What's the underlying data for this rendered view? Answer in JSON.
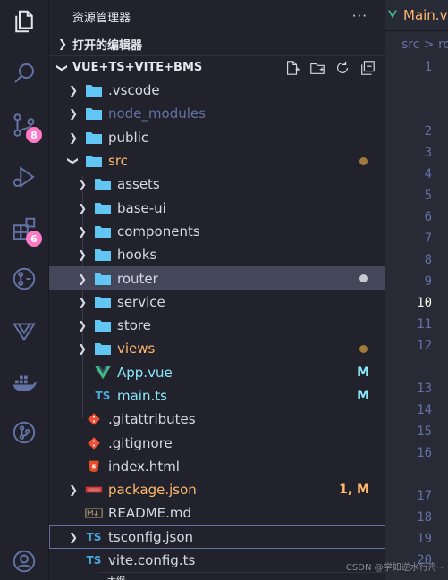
{
  "activity_bar": {
    "scm_badge": "8",
    "extensions_badge": "6"
  },
  "sidebar": {
    "title": "资源管理器",
    "more": "···",
    "open_editors": "打开的编辑器",
    "project": "VUE+TS+VITE+BMS",
    "tree": [
      {
        "label": ".vscode",
        "type": "folder",
        "depth": 1,
        "collapsed": true
      },
      {
        "label": "node_modules",
        "type": "folder",
        "depth": 1,
        "collapsed": true,
        "style": "dim"
      },
      {
        "label": "public",
        "type": "folder",
        "depth": 1,
        "collapsed": true
      },
      {
        "label": "src",
        "type": "folder",
        "depth": 1,
        "expanded": true,
        "style": "orange",
        "dot": "#a07a3a"
      },
      {
        "label": "assets",
        "type": "folder",
        "depth": 2,
        "collapsed": true
      },
      {
        "label": "base-ui",
        "type": "folder",
        "depth": 2,
        "collapsed": true
      },
      {
        "label": "components",
        "type": "folder",
        "depth": 2,
        "collapsed": true
      },
      {
        "label": "hooks",
        "type": "folder",
        "depth": 2,
        "collapsed": true
      },
      {
        "label": "router",
        "type": "folder",
        "depth": 2,
        "collapsed": true,
        "selected": true,
        "dot": "#c8c9d0"
      },
      {
        "label": "service",
        "type": "folder",
        "depth": 2,
        "collapsed": true
      },
      {
        "label": "store",
        "type": "folder",
        "depth": 2,
        "collapsed": true
      },
      {
        "label": "views",
        "type": "folder",
        "depth": 2,
        "collapsed": true,
        "style": "orange",
        "dot": "#a07a3a"
      },
      {
        "label": "App.vue",
        "type": "vue",
        "depth": 2,
        "style": "modified",
        "status": "M"
      },
      {
        "label": "main.ts",
        "type": "ts",
        "depth": 2,
        "style": "modified",
        "status": "M"
      },
      {
        "label": ".gitattributes",
        "type": "git",
        "depth": 1
      },
      {
        "label": ".gitignore",
        "type": "git",
        "depth": 1
      },
      {
        "label": "index.html",
        "type": "html",
        "depth": 1
      },
      {
        "label": "package.json",
        "type": "npm",
        "depth": 1,
        "collapsed": true,
        "style": "orange",
        "status": "1, M"
      },
      {
        "label": "README.md",
        "type": "md",
        "depth": 1
      },
      {
        "label": "tsconfig.json",
        "type": "tsconfig",
        "depth": 1,
        "collapsed": true,
        "focused": true
      },
      {
        "label": "vite.config.ts",
        "type": "ts",
        "depth": 1
      }
    ],
    "bottom_section": "大纲"
  },
  "editor": {
    "tab_label": "Main.vue",
    "breadcrumb": "src > ro",
    "line_numbers": [
      "1",
      "2",
      "3",
      "4",
      "5",
      "6",
      "7",
      "8",
      "9",
      "10",
      "11",
      "12",
      "13",
      "14",
      "15",
      "16",
      "17",
      "18",
      "19",
      "20"
    ],
    "current_line": "10"
  },
  "watermark": "CSDN @学如逆水行舟~",
  "colors": {
    "folder": "#62c6f5",
    "modified": "#8be9fd",
    "orange": "#ffb86c",
    "badge": "#ff79c6",
    "selection": "#44475a"
  }
}
